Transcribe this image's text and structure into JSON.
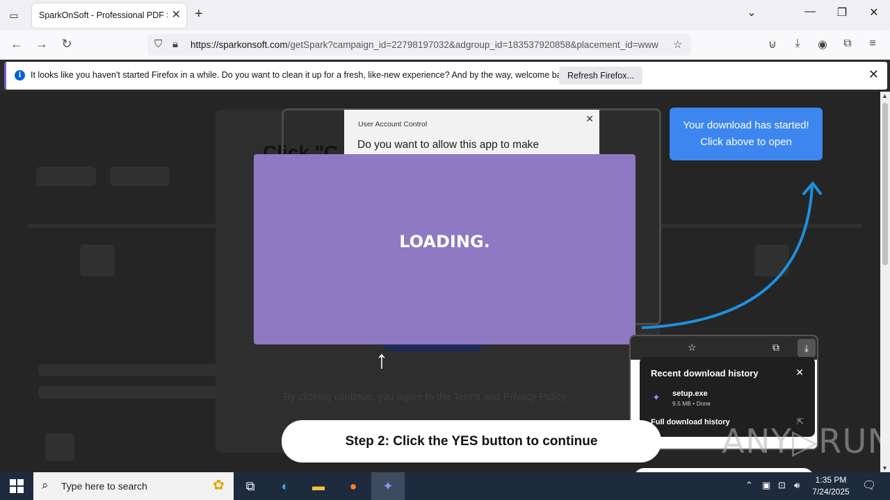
{
  "browser": {
    "tab_title": "SparkOnSoft - Professional PDF Soft",
    "url_domain": "https://sparkonsoft.com",
    "url_path": "/getSpark?campaign_id=22798197032&adgroup_id=183537920858&placement_id=www"
  },
  "notification": {
    "message": "It looks like you haven't started Firefox in a while. Do you want to clean it up for a fresh, like-new experience? And by the way, welcome back!",
    "button": "Refresh Firefox..."
  },
  "page": {
    "click_heading": "Click \"C",
    "uac_title": "User Account Control",
    "uac_question": "Do you want to allow this app to make",
    "loading": "LOADING.",
    "terms": "By clicking continue, you agree to the Terms and Privacy Policy",
    "download_note_line1": "Your download has started!",
    "download_note_line2": "Click above to open",
    "step": "Step 2: Click the YES button to continue",
    "history_title": "Recent download history",
    "history_file": "setup.exe",
    "history_meta": "9.5 MB • Done",
    "history_full": "Full download history",
    "watermark": "ANY▷RUN"
  },
  "taskbar": {
    "search_placeholder": "Type here to search",
    "time": "1:35 PM",
    "date": "7/24/2025"
  }
}
